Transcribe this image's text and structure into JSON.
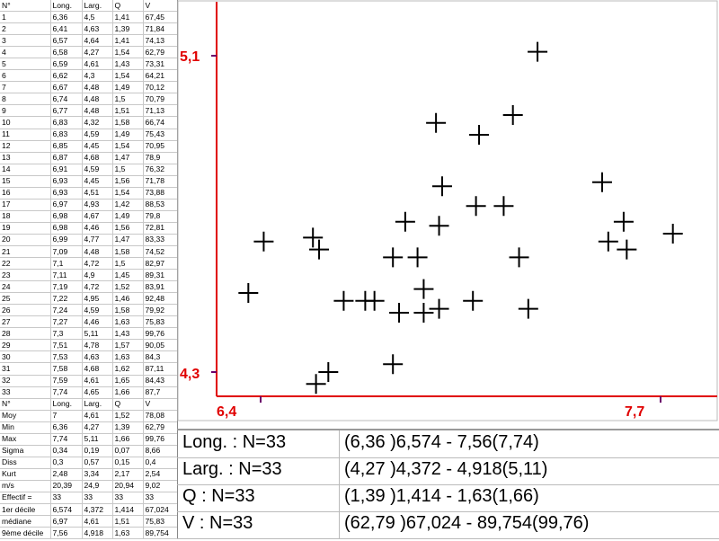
{
  "table": {
    "headers": [
      "N°",
      "Long.",
      "Larg.",
      "Q",
      "V"
    ],
    "rows": [
      [
        "1",
        "6,36",
        "4,5",
        "1,41",
        "67,45"
      ],
      [
        "2",
        "6,41",
        "4,63",
        "1,39",
        "71,84"
      ],
      [
        "3",
        "6,57",
        "4,64",
        "1,41",
        "74,13"
      ],
      [
        "4",
        "6,58",
        "4,27",
        "1,54",
        "62,79"
      ],
      [
        "5",
        "6,59",
        "4,61",
        "1,43",
        "73,31"
      ],
      [
        "6",
        "6,62",
        "4,3",
        "1,54",
        "64,21"
      ],
      [
        "7",
        "6,67",
        "4,48",
        "1,49",
        "70,12"
      ],
      [
        "8",
        "6,74",
        "4,48",
        "1,5",
        "70,79"
      ],
      [
        "9",
        "6,77",
        "4,48",
        "1,51",
        "71,13"
      ],
      [
        "10",
        "6,83",
        "4,32",
        "1,58",
        "66,74"
      ],
      [
        "11",
        "6,83",
        "4,59",
        "1,49",
        "75,43"
      ],
      [
        "12",
        "6,85",
        "4,45",
        "1,54",
        "70,95"
      ],
      [
        "13",
        "6,87",
        "4,68",
        "1,47",
        "78,9"
      ],
      [
        "14",
        "6,91",
        "4,59",
        "1,5",
        "76,32"
      ],
      [
        "15",
        "6,93",
        "4,45",
        "1,56",
        "71,78"
      ],
      [
        "16",
        "6,93",
        "4,51",
        "1,54",
        "73,88"
      ],
      [
        "17",
        "6,97",
        "4,93",
        "1,42",
        "88,53"
      ],
      [
        "18",
        "6,98",
        "4,67",
        "1,49",
        "79,8"
      ],
      [
        "19",
        "6,98",
        "4,46",
        "1,56",
        "72,81"
      ],
      [
        "20",
        "6,99",
        "4,77",
        "1,47",
        "83,33"
      ],
      [
        "21",
        "7,09",
        "4,48",
        "1,58",
        "74,52"
      ],
      [
        "22",
        "7,1",
        "4,72",
        "1,5",
        "82,97"
      ],
      [
        "23",
        "7,11",
        "4,9",
        "1,45",
        "89,31"
      ],
      [
        "24",
        "7,19",
        "4,72",
        "1,52",
        "83,91"
      ],
      [
        "25",
        "7,22",
        "4,95",
        "1,46",
        "92,48"
      ],
      [
        "26",
        "7,24",
        "4,59",
        "1,58",
        "79,92"
      ],
      [
        "27",
        "7,27",
        "4,46",
        "1,63",
        "75,83"
      ],
      [
        "28",
        "7,3",
        "5,11",
        "1,43",
        "99,76"
      ],
      [
        "29",
        "7,51",
        "4,78",
        "1,57",
        "90,05"
      ],
      [
        "30",
        "7,53",
        "4,63",
        "1,63",
        "84,3"
      ],
      [
        "31",
        "7,58",
        "4,68",
        "1,62",
        "87,11"
      ],
      [
        "32",
        "7,59",
        "4,61",
        "1,65",
        "84,43"
      ],
      [
        "33",
        "7,74",
        "4,65",
        "1,66",
        "87,7"
      ]
    ],
    "summary_headers": [
      "N°",
      "Long.",
      "Larg.",
      "Q",
      "V"
    ],
    "summary": [
      [
        "Moy",
        "7",
        "4,61",
        "1,52",
        "78,08"
      ],
      [
        "Min",
        "6,36",
        "4,27",
        "1,39",
        "62,79"
      ],
      [
        "Max",
        "7,74",
        "5,11",
        "1,66",
        "99,76"
      ],
      [
        "Sigma",
        "0,34",
        "0,19",
        "0,07",
        "8,66"
      ],
      [
        "Diss",
        "0,3",
        "0,57",
        "0,15",
        "0,4"
      ],
      [
        "Kurt",
        "2,48",
        "3,34",
        "2,17",
        "2,54"
      ],
      [
        "m/s",
        "20,39",
        "24,9",
        "20,94",
        "9,02"
      ],
      [
        "Effectif =",
        "33",
        "33",
        "33",
        "33"
      ],
      [
        "1er décile",
        "6,574",
        "4,372",
        "1,414",
        "67,024"
      ],
      [
        "médiane",
        "6,97",
        "4,61",
        "1,51",
        "75,83"
      ],
      [
        "9ème décile",
        "7,56",
        "4,918",
        "1,63",
        "89,754"
      ]
    ]
  },
  "chart_data": {
    "type": "scatter",
    "x_name": "Long.",
    "y_name": "Larg.",
    "xlim": [
      6.4,
      7.7
    ],
    "ylim": [
      4.3,
      5.1
    ],
    "x_tick_labels": [
      "6,4",
      "7,7"
    ],
    "y_tick_labels": [
      "4,3",
      "5,1"
    ],
    "axis_color": "#e00000",
    "marker_color": "#000000",
    "points": [
      [
        6.36,
        4.5
      ],
      [
        6.41,
        4.63
      ],
      [
        6.57,
        4.64
      ],
      [
        6.58,
        4.27
      ],
      [
        6.59,
        4.61
      ],
      [
        6.62,
        4.3
      ],
      [
        6.67,
        4.48
      ],
      [
        6.74,
        4.48
      ],
      [
        6.77,
        4.48
      ],
      [
        6.83,
        4.32
      ],
      [
        6.83,
        4.59
      ],
      [
        6.85,
        4.45
      ],
      [
        6.87,
        4.68
      ],
      [
        6.91,
        4.59
      ],
      [
        6.93,
        4.45
      ],
      [
        6.93,
        4.51
      ],
      [
        6.97,
        4.93
      ],
      [
        6.98,
        4.67
      ],
      [
        6.98,
        4.46
      ],
      [
        6.99,
        4.77
      ],
      [
        7.09,
        4.48
      ],
      [
        7.1,
        4.72
      ],
      [
        7.11,
        4.9
      ],
      [
        7.19,
        4.72
      ],
      [
        7.22,
        4.95
      ],
      [
        7.24,
        4.59
      ],
      [
        7.27,
        4.46
      ],
      [
        7.3,
        5.11
      ],
      [
        7.51,
        4.78
      ],
      [
        7.53,
        4.63
      ],
      [
        7.58,
        4.68
      ],
      [
        7.59,
        4.61
      ],
      [
        7.74,
        4.65
      ]
    ]
  },
  "stats": [
    {
      "label": "Long. : N=33",
      "value": "(6,36 )6,574 - 7,56(7,74)"
    },
    {
      "label": "Larg. : N=33",
      "value": "(4,27 )4,372 - 4,918(5,11)"
    },
    {
      "label": "Q : N=33",
      "value": "(1,39 )1,414 - 1,63(1,66)"
    },
    {
      "label": "V : N=33",
      "value": "(62,79 )67,024 - 89,754(99,76)"
    }
  ]
}
